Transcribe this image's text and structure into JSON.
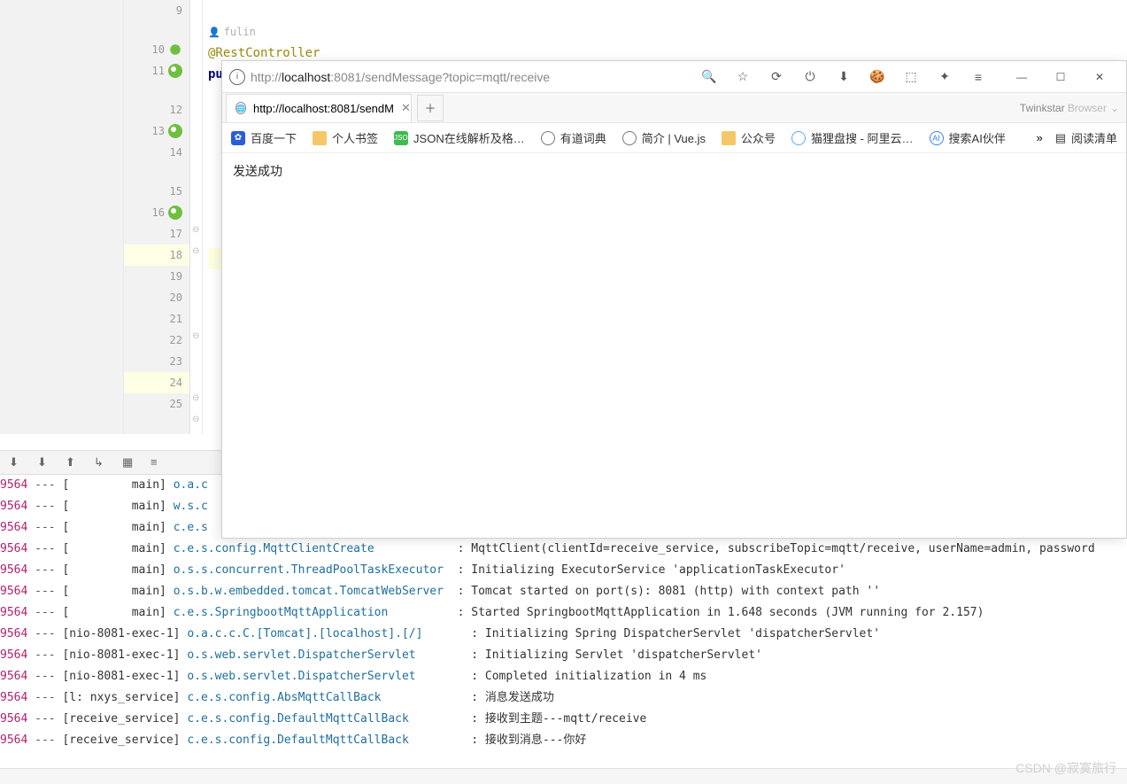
{
  "editor": {
    "hint_author": "fulin",
    "lines": {
      "9": "",
      "10": "@RestController",
      "11": "publ",
      "12": "",
      "13": "",
      "14": "",
      "15": "",
      "16": "",
      "17": "",
      "18": "",
      "19": "",
      "20": "",
      "21": "",
      "22": "",
      "23": "",
      "24": "",
      "25": ""
    },
    "selected_line": 18
  },
  "browser": {
    "url_prefix": "http://",
    "url_host": "localhost",
    "url_rest": ":8081/sendMessage?topic=mqtt/receive",
    "tab_title": "http://localhost:8081/sendM",
    "brand_bold": "Twinkstar",
    "brand_light": " Browser",
    "bookmarks": [
      {
        "icon": "baidu",
        "label": "百度一下"
      },
      {
        "icon": "folder",
        "label": "个人书签"
      },
      {
        "icon": "json",
        "label": "JSON在线解析及格…"
      },
      {
        "icon": "globe",
        "label": "有道词典"
      },
      {
        "icon": "globe",
        "label": "简介 | Vue.js"
      },
      {
        "icon": "folder",
        "label": "公众号"
      },
      {
        "icon": "cat",
        "label": "猫狸盘搜 - 阿里云…"
      },
      {
        "icon": "ai",
        "label": "搜索AI伙伴"
      }
    ],
    "reading_list": "阅读清单",
    "page_text": "发送成功"
  },
  "console": {
    "rows": [
      {
        "tid": "9564",
        "thread": "         main",
        "logger": "o.a.c",
        "msg": ""
      },
      {
        "tid": "9564",
        "thread": "         main",
        "logger": "w.s.c",
        "msg": ""
      },
      {
        "tid": "9564",
        "thread": "         main",
        "logger": "c.e.s",
        "msg": ""
      },
      {
        "tid": "9564",
        "thread": "         main",
        "logger": "c.e.s.config.MqttClientCreate",
        "msg": "MqttClient(clientId=receive_service, subscribeTopic=mqtt/receive, userName=admin, password"
      },
      {
        "tid": "9564",
        "thread": "         main",
        "logger": "o.s.s.concurrent.ThreadPoolTaskExecutor",
        "msg": "Initializing ExecutorService 'applicationTaskExecutor'"
      },
      {
        "tid": "9564",
        "thread": "         main",
        "logger": "o.s.b.w.embedded.tomcat.TomcatWebServer",
        "msg": "Tomcat started on port(s): 8081 (http) with context path ''"
      },
      {
        "tid": "9564",
        "thread": "         main",
        "logger": "c.e.s.SpringbootMqttApplication",
        "msg": "Started SpringbootMqttApplication in 1.648 seconds (JVM running for 2.157)"
      },
      {
        "tid": "9564",
        "thread": "nio-8081-exec-1",
        "logger": "o.a.c.c.C.[Tomcat].[localhost].[/]",
        "msg": "Initializing Spring DispatcherServlet 'dispatcherServlet'"
      },
      {
        "tid": "9564",
        "thread": "nio-8081-exec-1",
        "logger": "o.s.web.servlet.DispatcherServlet",
        "msg": "Initializing Servlet 'dispatcherServlet'"
      },
      {
        "tid": "9564",
        "thread": "nio-8081-exec-1",
        "logger": "o.s.web.servlet.DispatcherServlet",
        "msg": "Completed initialization in 4 ms"
      },
      {
        "tid": "9564",
        "thread": "l: nxys_service",
        "logger": "c.e.s.config.AbsMqttCallBack",
        "msg": "消息发送成功"
      },
      {
        "tid": "9564",
        "thread": "receive_service",
        "logger": "c.e.s.config.DefaultMqttCallBack",
        "msg": "接收到主题---mqtt/receive"
      },
      {
        "tid": "9564",
        "thread": "receive_service",
        "logger": "c.e.s.config.DefaultMqttCallBack",
        "msg": "接收到消息---你好"
      }
    ]
  },
  "watermark": "CSDN @寂寞旅行"
}
